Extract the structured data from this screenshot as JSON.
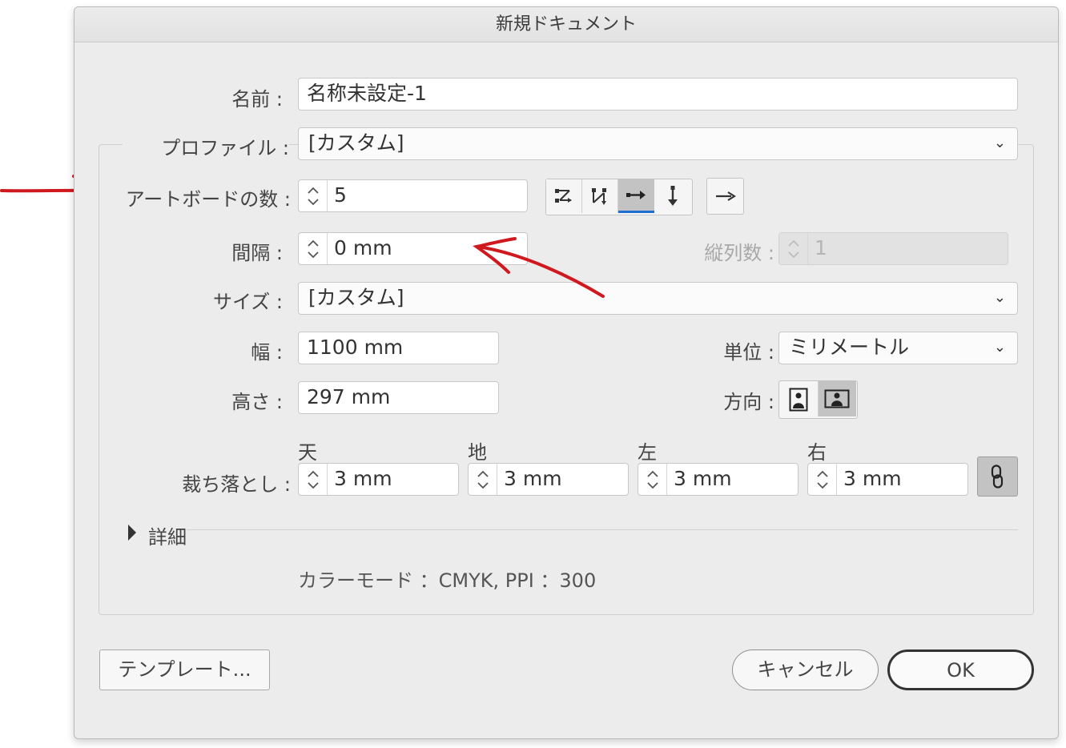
{
  "dialog": {
    "title": "新規ドキュメント"
  },
  "name": {
    "label": "名前 :",
    "value": "名称未設定-1"
  },
  "profile": {
    "label": "プロファイル :",
    "value": "[カスタム]"
  },
  "artboards": {
    "label": "アートボードの数 :",
    "value": "5",
    "layout_icons": [
      "grid-by-row-icon",
      "grid-by-column-icon",
      "arrange-by-row-icon",
      "arrange-by-column-icon"
    ],
    "selected_layout": "arrange-by-row-icon",
    "direction_icon": "left-to-right-arrow-icon"
  },
  "spacing": {
    "label": "間隔 :",
    "value": "0 mm"
  },
  "columns": {
    "label": "縦列数 :",
    "value": "1",
    "enabled": false
  },
  "size": {
    "label": "サイズ :",
    "value": "[カスタム]"
  },
  "width": {
    "label": "幅 :",
    "value": "1100 mm"
  },
  "height": {
    "label": "高さ :",
    "value": "297 mm"
  },
  "units": {
    "label": "単位 :",
    "value": "ミリメートル"
  },
  "orientation": {
    "label": "方向 :",
    "options": [
      "portrait-icon",
      "landscape-icon"
    ],
    "selected": "landscape-icon"
  },
  "bleed": {
    "label": "裁ち落とし :",
    "top_label": "天",
    "top": "3 mm",
    "bottom_label": "地",
    "bottom": "3 mm",
    "left_label": "左",
    "left": "3 mm",
    "right_label": "右",
    "right": "3 mm",
    "linked": true
  },
  "advanced": {
    "label": "詳細"
  },
  "summary": {
    "text": "カラーモード ：CMYK, PPI ：300"
  },
  "buttons": {
    "templates": "テンプレート...",
    "cancel": "キャンセル",
    "ok": "OK"
  },
  "colors": {
    "annotation_red": "#d0191f",
    "selected_tab": "#c3c3c3",
    "accent": "#333333"
  }
}
